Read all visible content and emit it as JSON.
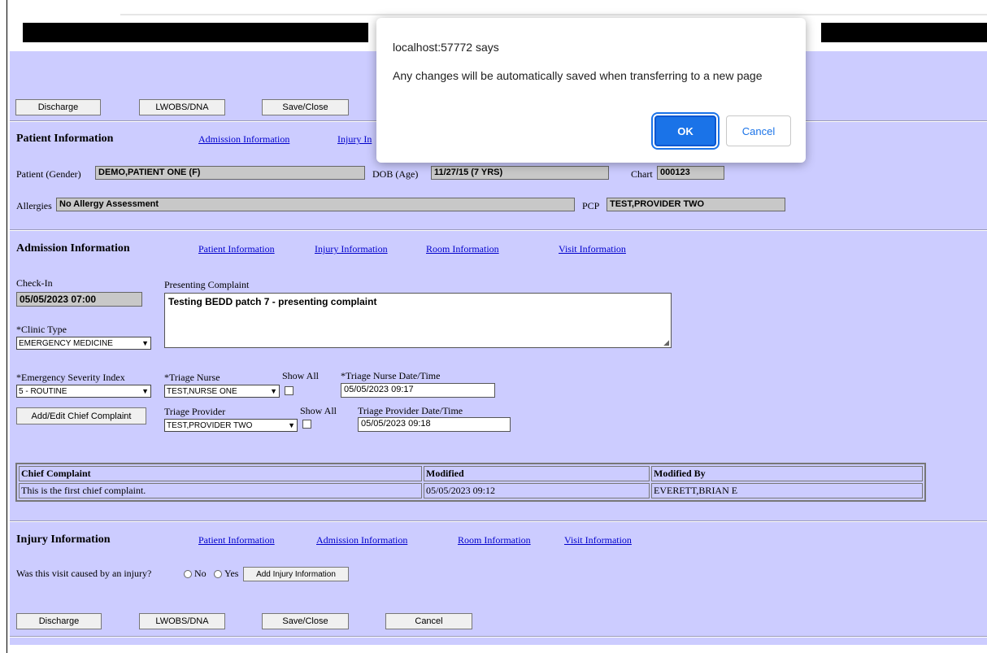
{
  "toolbar": {
    "discharge": "Discharge",
    "lwobs": "LWOBS/DNA",
    "save_close": "Save/Close",
    "cancel": "Cancel"
  },
  "patient_section": {
    "title": "Patient Information",
    "links": [
      "Admission Information",
      "Injury In"
    ],
    "gender_label": "Patient (Gender)",
    "gender_value": "DEMO,PATIENT ONE (F)",
    "dob_label": "DOB (Age)",
    "dob_value": "11/27/15 (7 YRS)",
    "chart_label": "Chart",
    "chart_value": "000123",
    "allergies_label": "Allergies",
    "allergies_value": "No Allergy Assessment",
    "pcp_label": "PCP",
    "pcp_value": "TEST,PROVIDER TWO"
  },
  "admission_section": {
    "title": "Admission Information",
    "links": [
      "Patient Information",
      "Injury Information",
      "Room Information",
      "Visit Information"
    ],
    "checkin_label": "Check-In",
    "checkin_value": "05/05/2023 07:00",
    "complaint_label": "Presenting Complaint",
    "complaint_value": "Testing BEDD patch 7 - presenting complaint",
    "clinic_label": "*Clinic Type",
    "clinic_value": "EMERGENCY MEDICINE",
    "esi_label": "*Emergency Severity Index",
    "esi_value": "5 - ROUTINE",
    "triage_nurse_label": "*Triage Nurse",
    "triage_nurse_value": "TEST,NURSE ONE",
    "show_all": "Show All",
    "triage_nurse_dt_label": "*Triage Nurse Date/Time",
    "triage_nurse_dt_value": "05/05/2023 09:17",
    "add_edit_chief": "Add/Edit Chief Complaint",
    "triage_provider_label": "Triage Provider",
    "triage_provider_value": "TEST,PROVIDER TWO",
    "triage_provider_dt_label": "Triage Provider Date/Time",
    "triage_provider_dt_value": "05/05/2023 09:18",
    "table": {
      "headers": [
        "Chief Complaint",
        "Modified",
        "Modified By"
      ],
      "rows": [
        [
          "This is the first chief complaint.",
          "05/05/2023 09:12",
          "EVERETT,BRIAN E"
        ]
      ]
    }
  },
  "injury_section": {
    "title": "Injury Information",
    "links": [
      "Patient Information",
      "Admission Information",
      "Room Information",
      "Visit Information"
    ],
    "question": "Was this visit caused by an injury?",
    "no": "No",
    "yes": "Yes",
    "add_injury": "Add Injury Information"
  },
  "dialog": {
    "title": "localhost:57772 says",
    "message": "Any changes will be automatically saved when transferring to a new page",
    "ok": "OK",
    "cancel": "Cancel"
  }
}
